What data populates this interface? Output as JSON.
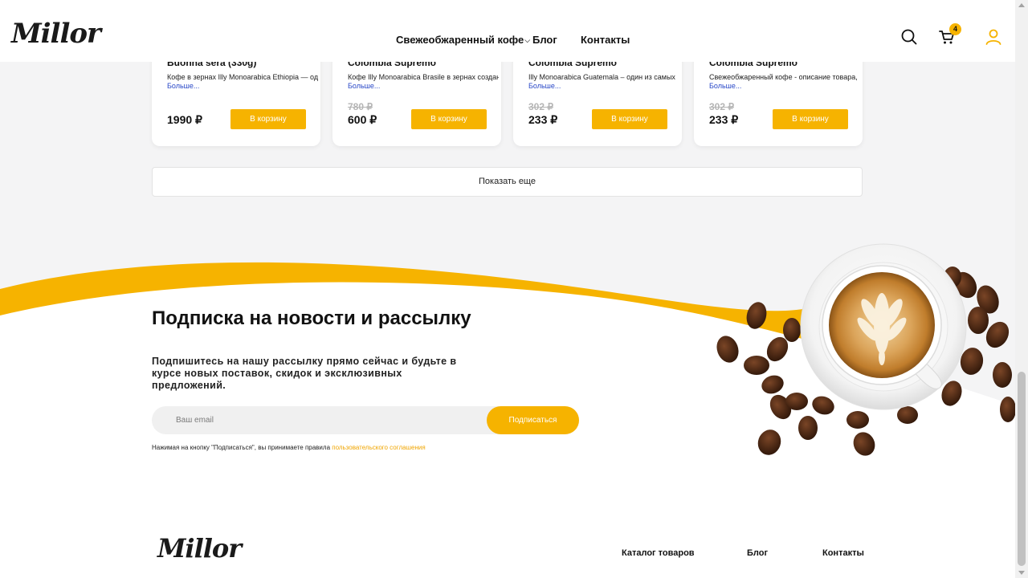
{
  "brand": {
    "logo_text": "Millor",
    "accent_color": "#f6b300"
  },
  "header": {
    "nav": [
      {
        "label": "Свежеобжаренный кофе",
        "has_dropdown": true
      },
      {
        "label": "Блог"
      },
      {
        "label": "Контакты"
      }
    ],
    "icons": [
      "search-icon",
      "cart-icon",
      "user-icon"
    ],
    "cart_count": "4"
  },
  "products": [
    {
      "title": "Buonna sera (330g)",
      "desc": "Кофе в зернах Illy Monoarabica Ethiopia — один",
      "more": "Больше...",
      "old_price": "",
      "price": "1990 ₽",
      "button": "В корзину"
    },
    {
      "title": "Colombia Supremo",
      "desc": "Кофе Illy Monoarabica Brasile в зернах создан",
      "more": "Больше...",
      "old_price": "780 ₽",
      "price": "600 ₽",
      "button": "В корзину"
    },
    {
      "title": "Colombia Supremo",
      "desc": "Illy Monoarabica Guatemala – один из самых",
      "more": "Больше...",
      "old_price": "302 ₽",
      "price": "233 ₽",
      "button": "В корзину"
    },
    {
      "title": "Colombia Supremo",
      "desc": "Свежеобжаренный кофе - описание товара,",
      "more": "Больше...",
      "old_price": "302 ₽",
      "price": "233 ₽",
      "button": "В корзину"
    }
  ],
  "show_more": "Показать еще",
  "subscribe": {
    "title": "Подписка на новости и рассылку",
    "text": "Подпишитесь на нашу рассылку прямо сейчас и будьте в курсе новых поставок, скидок и эксклюзивных предложений.",
    "email_placeholder": "Ваш email",
    "button": "Подписаться",
    "agree_text": "Нажимая на кнопку \"Подписаться\", вы принимаете правила ",
    "agree_link": "пользовательского соглашения"
  },
  "footer": {
    "logo_text": "Millor",
    "links": [
      "Каталог товаров",
      "Блог",
      "Контакты"
    ]
  }
}
